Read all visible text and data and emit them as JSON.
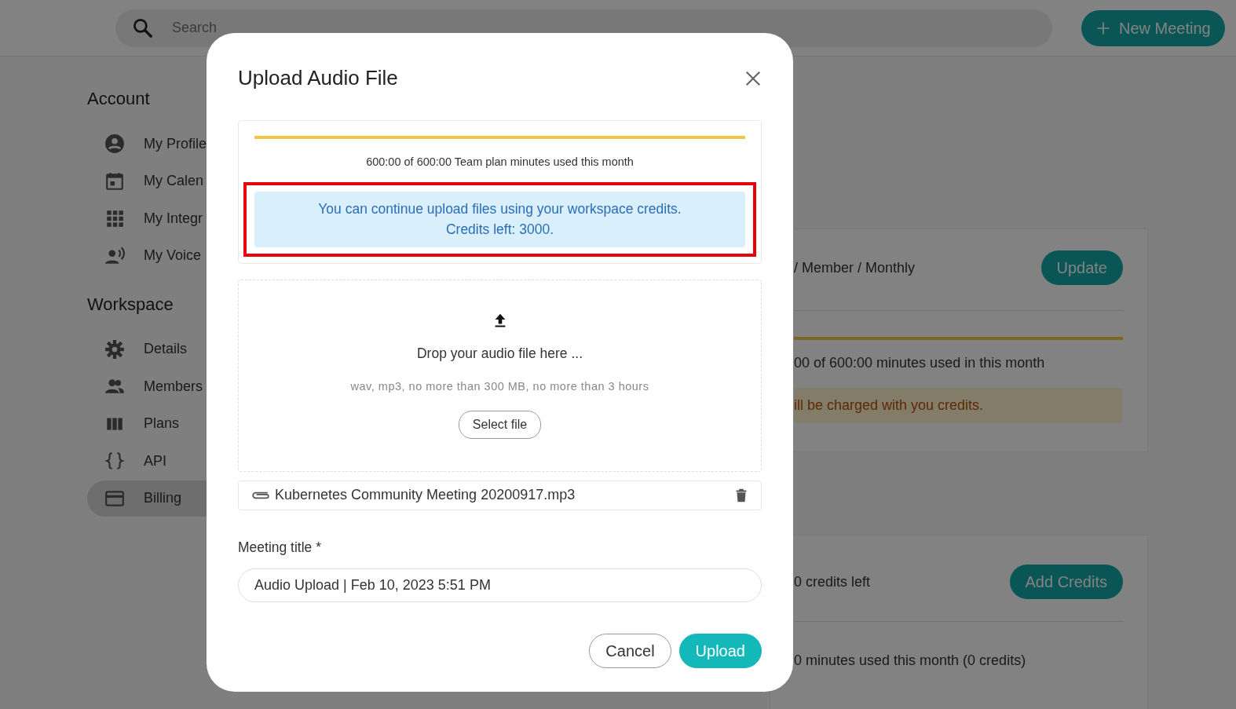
{
  "topbar": {
    "search": {
      "placeholder": "Search"
    },
    "new_meeting_button": "New Meeting"
  },
  "sidebar": {
    "sections": [
      {
        "heading": "Account",
        "items": [
          {
            "label": "My Profile",
            "selected": false
          },
          {
            "label": "My Calen",
            "selected": false
          },
          {
            "label": "My Integr",
            "selected": false
          },
          {
            "label": "My Voice",
            "selected": false
          }
        ]
      },
      {
        "heading": "Workspace",
        "items": [
          {
            "label": "Details",
            "selected": false
          },
          {
            "label": "Members",
            "selected": false
          },
          {
            "label": "Plans",
            "selected": false
          },
          {
            "label": "API",
            "selected": false
          },
          {
            "label": "Billing",
            "selected": true
          }
        ]
      }
    ]
  },
  "billing": {
    "plan_card": {
      "plan_text": "/ Member / Monthly",
      "update_button": "Update",
      "usage": {
        "level": 1,
        "text": "00 of 600:00 minutes used in this month"
      },
      "warning": "ill be charged with you credits."
    },
    "credits_card": {
      "credits_text": "0 credits left",
      "add_credits_button": "Add Credits",
      "usage_text": "0 minutes used this month (0 credits)"
    }
  },
  "modal": {
    "title": "Upload Audio File",
    "usage": {
      "level": 1,
      "text": "600:00 of 600:00 Team plan minutes used this month"
    },
    "notice": {
      "highlighted": true,
      "lines": [
        "You can continue upload files using your workspace credits.",
        "Credits left: 3000."
      ]
    },
    "drop_zone": {
      "title": "Drop your audio file here ...",
      "hint": "wav, mp3, no more than 300 MB, no more than 3 hours",
      "button": "Select file"
    },
    "file": {
      "name": "Kubernetes Community Meeting 20200917.mp3"
    },
    "title_field": {
      "label": "Meeting title *",
      "value": "Audio Upload | Feb 10, 2023 5:51 PM"
    },
    "buttons": [
      {
        "kind": "secondary",
        "label": "Cancel"
      },
      {
        "kind": "primary",
        "label": "Upload"
      }
    ]
  }
}
